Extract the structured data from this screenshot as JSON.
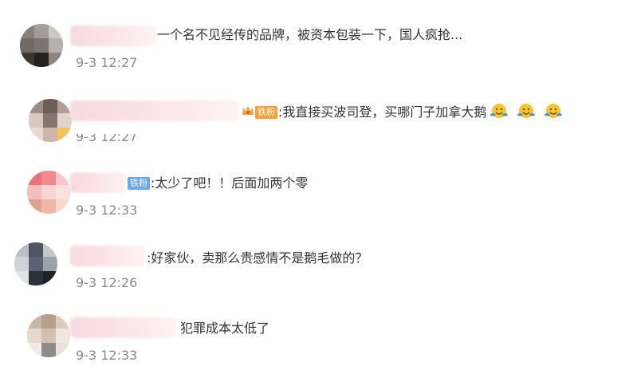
{
  "comments": [
    {
      "text": "一个名不见经传的品牌，被资本包装一下，国人疯抢...",
      "time": "9-3 12:27",
      "badge": ""
    },
    {
      "text": ":我直接买波司登，买哪门子加拿大鹅",
      "time": "9-3 12:27",
      "badge": "铁粉",
      "emoji": [
        "smiley-icon",
        "smiley-icon",
        "smiley-icon"
      ]
    },
    {
      "text": ":太少了吧！！后面加两个零",
      "time": "9-3 12:33",
      "badge": "铁粉"
    },
    {
      "text": ":好家伙，卖那么贵感情不是鹅毛做的？",
      "time": "9-3 12:26",
      "badge": ""
    },
    {
      "text": "犯罪成本太低了",
      "time": "9-3 12:33",
      "badge": ""
    }
  ],
  "colors": {
    "text": "#333333",
    "time": "#8a8a8a",
    "badge_blue": "#6aa9e9",
    "badge_orange": "#f2a33a"
  }
}
